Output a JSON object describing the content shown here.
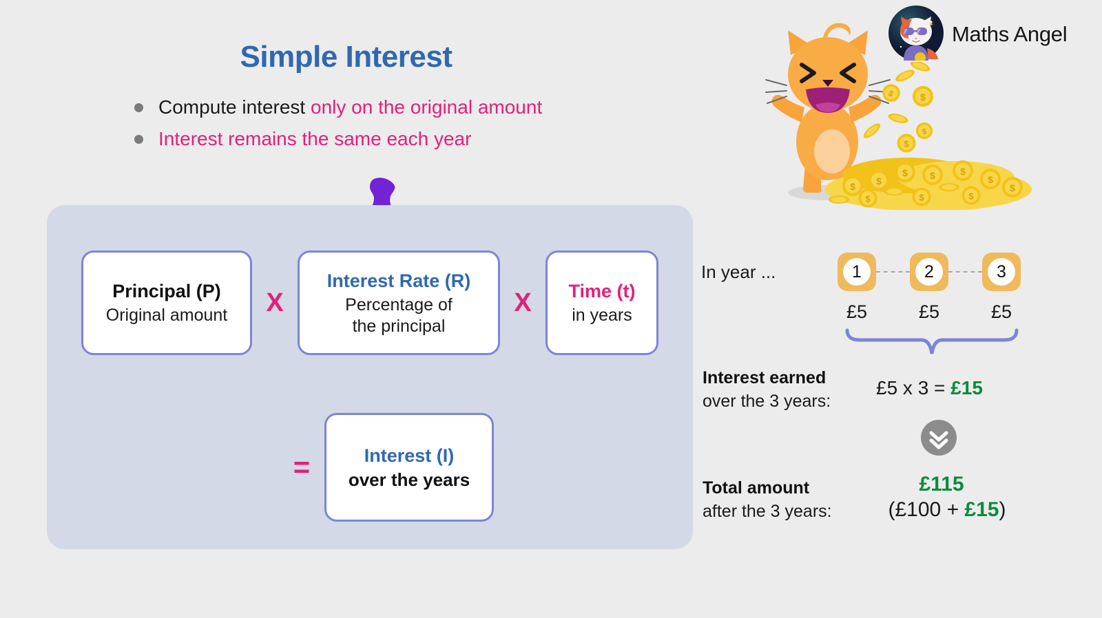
{
  "page": {
    "background_color": "#ececec",
    "title": "Simple Interest",
    "title_color": "#3068b0"
  },
  "brand": {
    "name": "Maths Angel",
    "logo_icon": "cat-with-sunglasses-logo-icon"
  },
  "bullets": [
    {
      "lead": "Compute interest ",
      "highlight": "only on the original amount"
    },
    {
      "lead": "",
      "highlight": "Interest remains the same each year"
    }
  ],
  "decor": {
    "pushpin_icon": "purple-pushpin-icon",
    "mascot_icon": "happy-orange-cat-mascot-icon",
    "coins_icon": "falling-gold-coins-pile-icon",
    "brace_icon": "curly-brace-icon",
    "chevron_icon": "double-chevron-down-icon"
  },
  "formula": {
    "panel_color": "#d3d9e6",
    "box_border_color": "#7b86d6",
    "operator_color": "#e0217c",
    "terms": [
      {
        "head": "Principal (P)",
        "head_color": "black",
        "sub": "Original amount",
        "sub_bold": false
      },
      {
        "head": "Interest Rate (R)",
        "head_color": "blue",
        "sub": "Percentage of\nthe principal",
        "sub_bold": false
      },
      {
        "head": "Time (t)",
        "head_color": "pink",
        "sub": "in years",
        "sub_bold": false
      }
    ],
    "operator_multiply": "X",
    "operator_equals": "=",
    "result": {
      "head": "Interest (I)",
      "head_color": "blue",
      "sub": "over the years",
      "sub_bold": true
    }
  },
  "example": {
    "in_year_label": "In year ...",
    "years": [
      "1",
      "2",
      "3"
    ],
    "year_amounts": [
      "£5",
      "£5",
      "£5"
    ],
    "year_badge_color": "#f0b95c",
    "interest_earned": {
      "title": "Interest earned",
      "subtitle": "over the 3 years:",
      "expression_left": "£5 x 3 = ",
      "expression_result": "£15"
    },
    "total_amount": {
      "title": "Total amount",
      "subtitle": "after the 3 years:",
      "value": "£115",
      "breakdown_open": "(£100 + ",
      "breakdown_result": "£15",
      "breakdown_close": ")"
    },
    "result_color": "#0b8a3e"
  }
}
